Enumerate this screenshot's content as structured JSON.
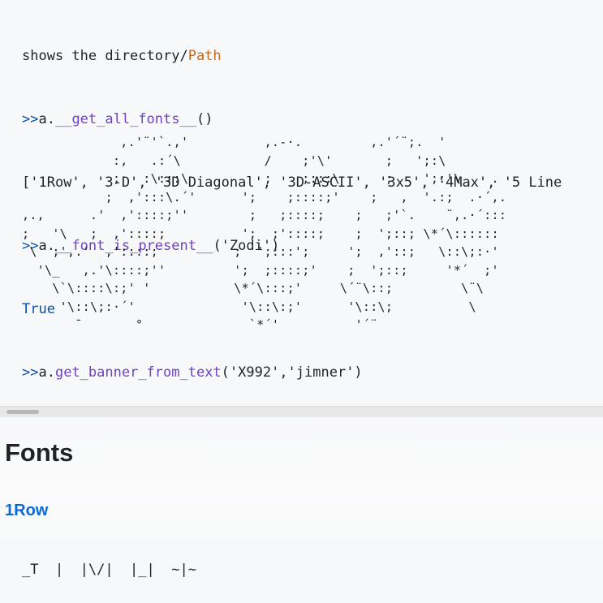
{
  "code": {
    "line0_text": "shows the directory/",
    "line0_path": "Path",
    "prompt": ">>",
    "line1_obj": "a.",
    "line1_fn": "__get_all_fonts__",
    "line1_args": "()",
    "line2_output": "['1Row', '3-D', '3D Diagonal', '3D-ASCII', '3x5', '4Max', '5 Line",
    "line3_obj": "a.",
    "line3_fn": "__font_is_present__",
    "line3_args": "('Zodi')",
    "line4_output": "True",
    "line5_obj": "a.",
    "line5_fn": "get_banner_from_text",
    "line5_args": "('X992','jimner')",
    "ascii_art": "             ,.'¨'`.,'          ,.-·.         ,.'´¨;.  '\n            :,   .:´\\           /    ;'\\'       ;   ';:\\\n            ;   :\\:::\\          ;    ;:::\\      ;    ';:'\\    .\n           ;  ,':::\\.´'      ';    ;::::;'    ;   ,  '.:;  .·´,.\n,.,      .'  ,'::::;''        ;   ;::::;    ;   ;'`.    ¨,.·´:::\n;   '\\   ;  ,'::::;          ';  ;'::::;    ;  ';::; \\*´\\::::::\n \\  ;',.'  ,'::::;          ;  ';:::';     ';  ,'::;   \\::\\;:·'\n  '\\_   ,.'\\::::;''         ';  ;::::;'    ;  ';::;     '*´  ;'\n    \\`\\::::\\:;' '           \\*´\\:::;'     \\´¨\\::;         \\¨\\\n     '\\::\\;:·´'              '\\::\\:;'      '\\::\\;          \\\n       ¯       °              `*´'          '´¨"
  },
  "section": {
    "title": "Fonts",
    "font_name": "1Row",
    "sample": "_T  |  |\\/|  |_|  ~|~"
  }
}
